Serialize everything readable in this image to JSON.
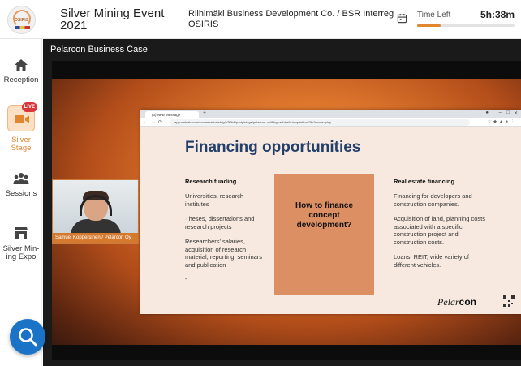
{
  "header": {
    "event_title": "Silver Mining Event 2021",
    "organizer": "Riihimäki Business Development Co. / BSR Interreg OSIRIS",
    "time_left_label": "Time Left",
    "time_left_value": "5h:38m",
    "time_progress_fraction": 0.24
  },
  "sidebar": {
    "items": [
      {
        "label": "Reception",
        "icon": "home-icon"
      },
      {
        "label": "Silver Stage",
        "icon": "video-camera-icon",
        "badge": "LIVE"
      },
      {
        "label": "Sessions",
        "icon": "people-icon"
      },
      {
        "label": "Silver Min-ing Expo",
        "icon": "booth-icon"
      }
    ]
  },
  "stage": {
    "title": "Pelarcon Business Case",
    "speaker_name": "Samuel Koppersinen / Pelarcon Oy"
  },
  "browser": {
    "tab_title": "(3) New Message",
    "url": "app.wahlab.com/conversation/sbfg/a7f9b6/party/stage/pelarcon-oy/9fbg=a/4dfe94/acquisition/2fk?mode=play"
  },
  "slide": {
    "title": "Financing opportunities",
    "left_heading": "Research funding",
    "left_p1": "Universities, research institutes",
    "left_p2": "Theses, dissertations and research projects",
    "left_p3": "Researchers' salaries, acquisition of research material, reporting, seminars and publication",
    "left_p4": "-",
    "center_text": "How to finance concept development?",
    "right_heading": "Real estate financing",
    "right_p1": "Financing for developers and construction companies.",
    "right_p2": "Acquisition of land, planning costs associated with a specific construction project and construction costs.",
    "right_p3": "Loans, REIT, wide variety of different vehicles.",
    "brand_part1": "Pelar",
    "brand_part2": "con"
  },
  "colors": {
    "accent": "#e2852f",
    "fab": "#1b73c7",
    "slide_title": "#23406b"
  }
}
